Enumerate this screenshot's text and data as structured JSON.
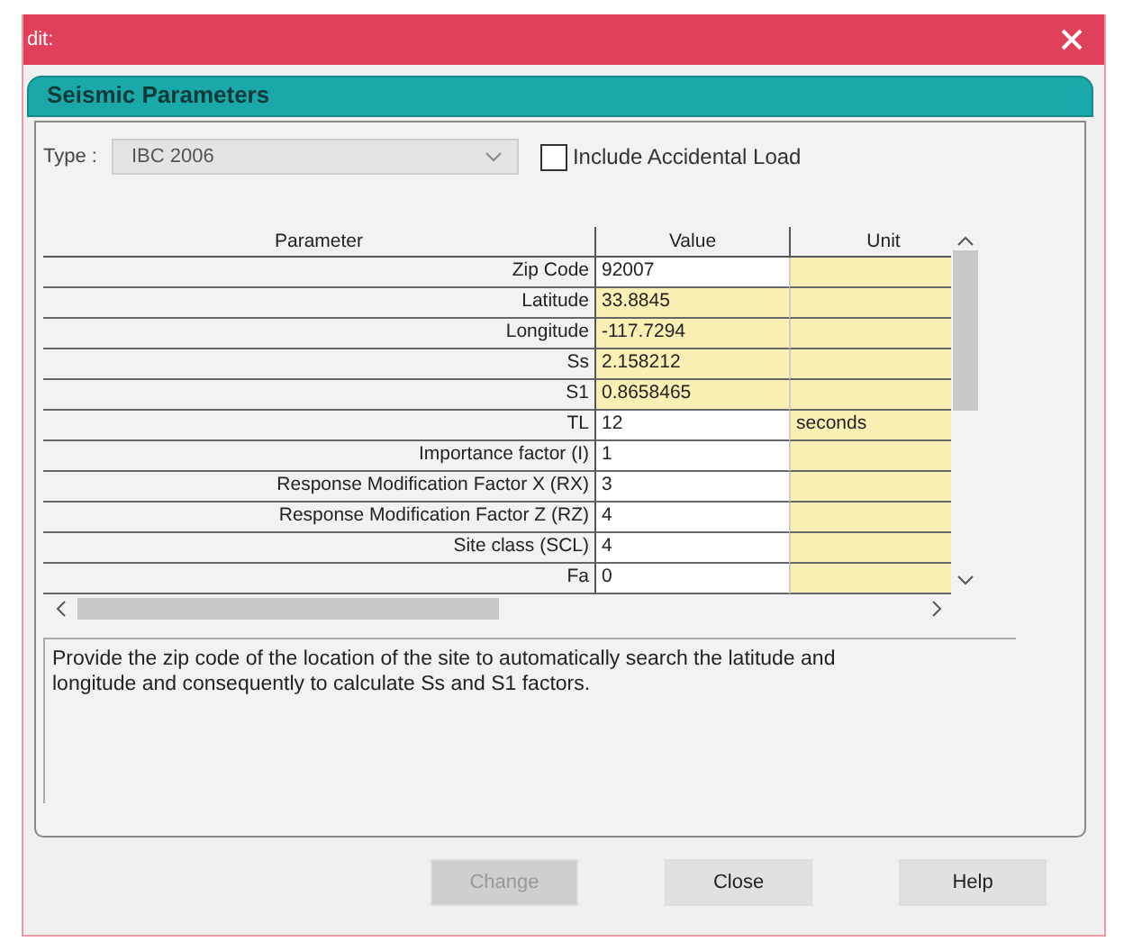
{
  "window": {
    "title": "dit:"
  },
  "panel": {
    "title": "Seismic Parameters"
  },
  "type_field": {
    "label": "Type :",
    "value": "IBC 2006",
    "disabled": true
  },
  "accidental_load": {
    "label": "Include Accidental Load",
    "checked": false
  },
  "table": {
    "columns": [
      "Parameter",
      "Value",
      "Unit"
    ],
    "rows": [
      {
        "parameter": "Zip Code",
        "value": "92007",
        "unit": "",
        "readonly": false
      },
      {
        "parameter": "Latitude",
        "value": "33.8845",
        "unit": "",
        "readonly": true
      },
      {
        "parameter": "Longitude",
        "value": "-117.7294",
        "unit": "",
        "readonly": true
      },
      {
        "parameter": "Ss",
        "value": "2.158212",
        "unit": "",
        "readonly": true
      },
      {
        "parameter": "S1",
        "value": "0.8658465",
        "unit": "",
        "readonly": true
      },
      {
        "parameter": "TL",
        "value": "12",
        "unit": "seconds",
        "readonly": false
      },
      {
        "parameter": "Importance factor (I)",
        "value": "1",
        "unit": "",
        "readonly": false
      },
      {
        "parameter": "Response Modification Factor X (RX)",
        "value": "3",
        "unit": "",
        "readonly": false
      },
      {
        "parameter": "Response Modification Factor Z (RZ)",
        "value": "4",
        "unit": "",
        "readonly": false
      },
      {
        "parameter": "Site class (SCL)",
        "value": "4",
        "unit": "",
        "readonly": false
      },
      {
        "parameter": "Fa",
        "value": "0",
        "unit": "",
        "readonly": false
      }
    ]
  },
  "description": "Provide the zip code of the location of the site to automatically search the latitude and longitude and consequently to calculate Ss and S1 factors.",
  "buttons": [
    {
      "label": "Change",
      "disabled": true
    },
    {
      "label": "Close",
      "disabled": false
    },
    {
      "label": "Help",
      "disabled": false
    }
  ]
}
